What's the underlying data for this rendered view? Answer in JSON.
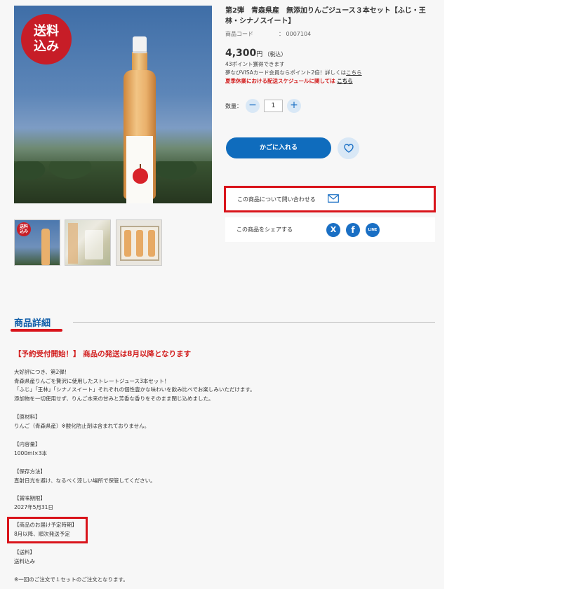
{
  "product": {
    "badge_line1": "送料",
    "badge_line2": "込み",
    "thumb_badge_line1": "送料",
    "thumb_badge_line2": "込み",
    "title": "第2弾　青森県産　無添加りんごジュース３本セット【ふじ・王林・シナノスイート】",
    "code_label": "商品コード",
    "code_value": "：  0007104",
    "price": "4,300",
    "price_unit": "円",
    "tax_note": "（税込）",
    "points_text": "43ポイント獲得できます",
    "visa_text": "夢なびVISAカード会員ならポイント2倍！詳しくは",
    "visa_link": "こちら",
    "summer_text": "夏季休業における配送スケジュールに関しては ",
    "summer_link": "こちら"
  },
  "purchase": {
    "qty_label": "数量：",
    "qty_minus": "−",
    "qty_value": "1",
    "qty_plus": "+",
    "cart_button": "かごに入れる"
  },
  "inquiry": {
    "label": "この商品について問い合わせる"
  },
  "share": {
    "label": "この商品をシェアする",
    "x_label": "X",
    "facebook_label": "f",
    "line_label": "LINE"
  },
  "details": {
    "heading": "商品詳細",
    "notice": "【予約受付開始！】 商品の発送は8月以降となります",
    "intro": [
      "大好評につき、第2弾！",
      "青森県産りんごを贅沢に使用したストレートジュース3本セット！",
      "「ふじ」「王林」「シナノスイート」それぞれの個性豊かな味わいを飲み比べでお楽しみいただけます。",
      "添加物を一切使用せず、りんご本来の甘みと芳香な香りをそのまま閉じ込めました。"
    ],
    "ingredients_head": "【原材料】",
    "ingredients": "りんご（青森県産）※酸化防止剤は含まれておりません。",
    "volume_head": "【内容量】",
    "volume": "1000ml×3本",
    "storage_head": "【保存方法】",
    "storage": "直射日光を避け、なるべく涼しい場所で保管してください。",
    "expiry_head": "【賞味期限】",
    "expiry": "2027年5月31日",
    "delivery_head": "【商品のお届け予定時期】",
    "delivery": "8月以降、順次発送予定",
    "shipping_head": "【送料】",
    "shipping": "送料込み",
    "footnote": "※一回のご注文で１セットのご注文となります。"
  },
  "colors": {
    "accent_blue": "#0f6cbd",
    "alert_red": "#d9141b"
  }
}
